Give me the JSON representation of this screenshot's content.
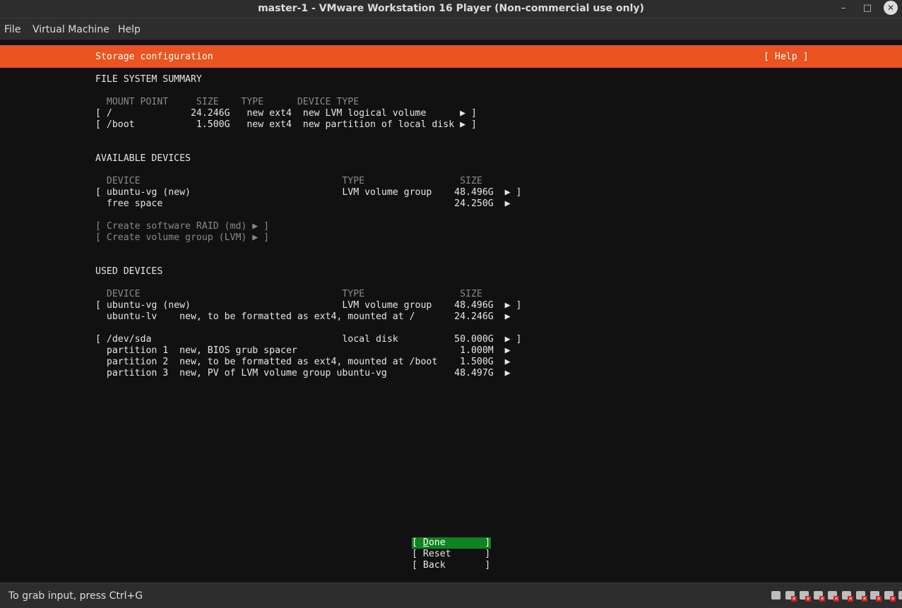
{
  "window": {
    "title": "master-1 - VMware Workstation 16 Player (Non-commercial use only)",
    "minimize_glyph": "–",
    "maximize_glyph": "□",
    "close_glyph": "✕"
  },
  "menubar": {
    "items": [
      "File",
      "Virtual Machine",
      "Help"
    ]
  },
  "screen": {
    "header": {
      "title": "Storage configuration",
      "help": "[ Help ]"
    },
    "fs_summary": {
      "heading": "FILE SYSTEM SUMMARY",
      "columns": "  MOUNT POINT     SIZE    TYPE      DEVICE TYPE",
      "rows": [
        "[ /              24.246G   new ext4  new LVM logical volume      ▶ ]",
        "[ /boot           1.500G   new ext4  new partition of local disk ▶ ]"
      ]
    },
    "available": {
      "heading": "AVAILABLE DEVICES",
      "columns": "  DEVICE                                    TYPE                 SIZE",
      "rows": [
        "[ ubuntu-vg (new)                           LVM volume group    48.496G  ▶ ]",
        "  free space                                                    24.250G  ▶"
      ],
      "actions": [
        "[ Create software RAID (md) ▶ ]",
        "[ Create volume group (LVM) ▶ ]"
      ]
    },
    "used": {
      "heading": "USED DEVICES",
      "columns": "  DEVICE                                    TYPE                 SIZE",
      "rows": [
        "[ ubuntu-vg (new)                           LVM volume group    48.496G  ▶ ]",
        "  ubuntu-lv    new, to be formatted as ext4, mounted at /       24.246G  ▶",
        "[ /dev/sda                                  local disk          50.000G  ▶ ]",
        "  partition 1  new, BIOS grub spacer                             1.000M  ▶",
        "  partition 2  new, to be formatted as ext4, mounted at /boot    1.500G  ▶",
        "  partition 3  new, PV of LVM volume group ubuntu-vg            48.497G  ▶"
      ]
    },
    "buttons": {
      "done_open": "[ ",
      "done_key": "D",
      "done_rest": "one       ]",
      "reset": "[ Reset      ]",
      "back": "[ Back       ]"
    }
  },
  "statusbar": {
    "text": "To grab input, press Ctrl+G",
    "tray_icons": [
      "hard-disk-icon",
      "cd-rom-icon",
      "cd-rom-icon",
      "floppy-icon",
      "network-icon",
      "printer-icon",
      "usb-icon",
      "sound-icon",
      "display-icon",
      "message-icon"
    ],
    "error_mark": "✕"
  }
}
